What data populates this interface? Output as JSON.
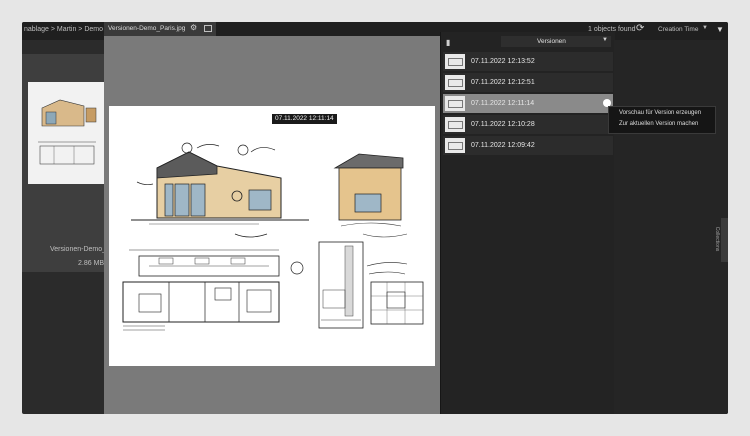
{
  "topbar": {
    "breadcrumb": "nablage > Martin > Demo",
    "tab_title": "Versionen-Demo_Paris.jpg",
    "objects_found": "1 objects found",
    "sort_label": "Creation Time"
  },
  "grid": {
    "item_name": "Versionen-Demo_",
    "item_size": "2.86 MB"
  },
  "preview": {
    "timestamp": "07.11.2022 12:11:14"
  },
  "versions": {
    "dropdown_label": "Versionen",
    "items": [
      {
        "time": "07.11.2022 12:13:52",
        "active": false
      },
      {
        "time": "07.11.2022 12:12:51",
        "active": false
      },
      {
        "time": "07.11.2022 12:11:14",
        "active": true
      },
      {
        "time": "07.11.2022 12:10:28",
        "active": false
      },
      {
        "time": "07.11.2022 12:09:42",
        "active": false
      }
    ]
  },
  "context_menu": {
    "items": [
      "Vorschau für Version erzeugen",
      "Zur aktuellen Version machen"
    ]
  },
  "side_tab": "Collections",
  "icons": {
    "gear": "gear-icon",
    "split": "split-view-icon",
    "refresh": "refresh-icon",
    "lock": "lock-icon",
    "menu": "menu-caret-icon"
  }
}
